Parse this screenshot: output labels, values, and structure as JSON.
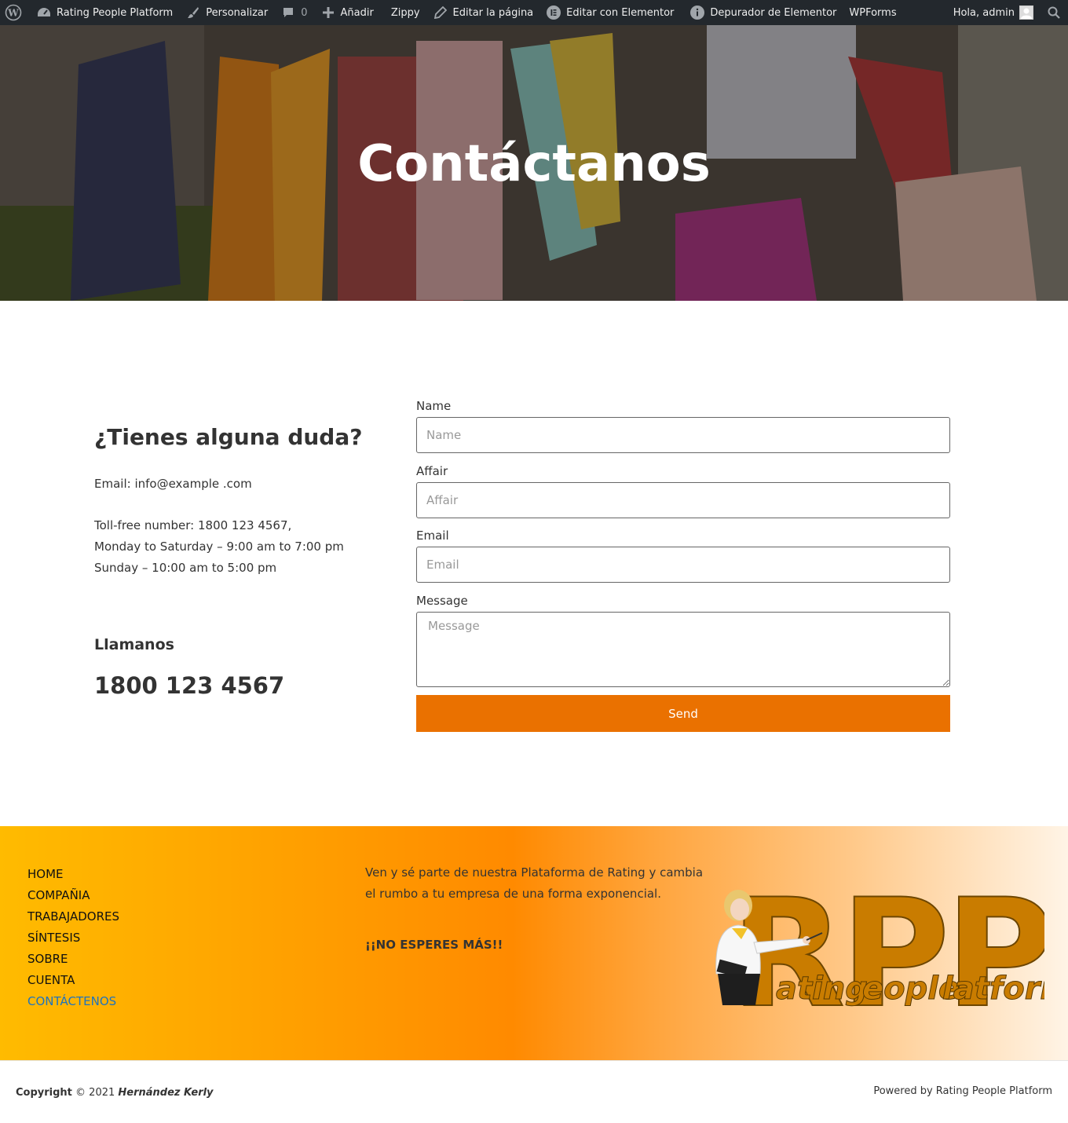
{
  "admin_bar": {
    "site_name": "Rating People Platform",
    "customize": "Personalizar",
    "comments_count": "0",
    "add_new": "Añadir",
    "zippy": "Zippy",
    "edit_page": "Editar la página",
    "edit_elementor": "Editar con Elementor",
    "elementor_debugger": "Depurador de Elementor",
    "wpforms": "WPForms",
    "greeting": "Hola, admin"
  },
  "hero": {
    "title": "Contáctanos"
  },
  "contact_info": {
    "title": "¿Tienes alguna duda?",
    "email": "Email: info@example .com",
    "toll_free": "Toll-free number: 1800 123 4567,",
    "weekday_hours": "Monday to Saturday – 9:00 am to 7:00 pm",
    "sunday_hours": "Sunday – 10:00 am to 5:00 pm",
    "call_title": "Llamanos",
    "phone": "1800 123 4567"
  },
  "form": {
    "name_label": "Name",
    "name_placeholder": "Name",
    "affair_label": "Affair",
    "affair_placeholder": "Affair",
    "email_label": "Email",
    "email_placeholder": "Email",
    "message_label": "Message",
    "message_placeholder": "Message",
    "send_label": "Send",
    "button_color": "#ea7100"
  },
  "footer": {
    "menu": [
      "HOME",
      "COMPAÑIA",
      "TRABAJADORES",
      "SÍNTESIS",
      "SOBRE",
      "CUENTA",
      "CONTÁCTENOS"
    ],
    "active_item": "CONTÁCTENOS",
    "description": "Ven y sé parte de nuestra Plataforma de Rating y cambia el rumbo a tu empresa de una forma exponencial.",
    "cta": "¡¡NO ESPERES MÁS!!",
    "logo_letters": "RPP",
    "logo_words": [
      "ating",
      "eople",
      "latform"
    ]
  },
  "bottom_bar": {
    "copyright_label": "Copyright",
    "copyright_year": "© 2021",
    "author": "Hernández Kerly",
    "powered_by": "Powered by Rating People Platform"
  },
  "colors": {
    "admin_bar_bg": "#23282d",
    "accent_orange": "#ea7100",
    "active_link": "#1e73be"
  }
}
